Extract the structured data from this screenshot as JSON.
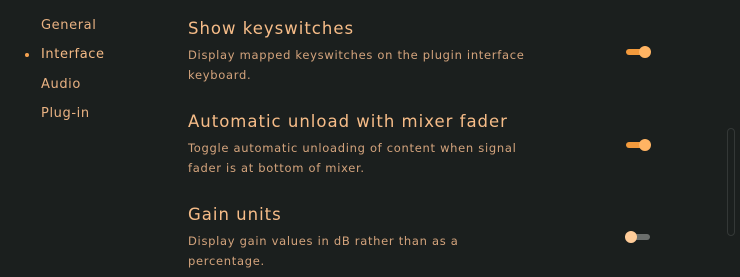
{
  "sidebar": {
    "items": [
      {
        "label": "General",
        "active": false
      },
      {
        "label": "Interface",
        "active": true
      },
      {
        "label": "Audio",
        "active": false
      },
      {
        "label": "Plug-in",
        "active": false
      }
    ]
  },
  "settings": [
    {
      "title": "Show keyswitches",
      "description": "Display mapped keyswitches on the plugin interface keyboard.",
      "enabled": true
    },
    {
      "title": "Automatic unload with mixer fader",
      "description": "Toggle automatic unloading of content when signal fader is at bottom of mixer.",
      "enabled": true
    },
    {
      "title": "Gain units",
      "description": "Display gain values in dB rather than as a percentage.",
      "enabled": false
    }
  ],
  "colors": {
    "background": "#1b1f1e",
    "accent": "#f39a3c",
    "text": "#f6bc88"
  }
}
